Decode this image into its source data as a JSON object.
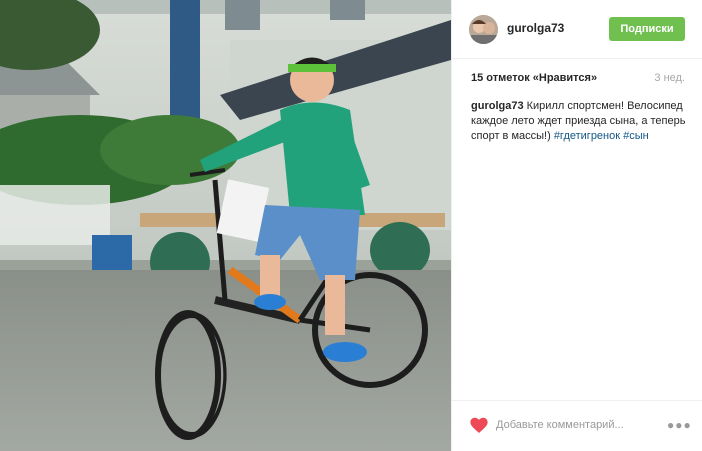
{
  "author": {
    "username": "gurolga73",
    "avatar_icon": "avatar-photo"
  },
  "header": {
    "follow_label": "Подписки"
  },
  "stats": {
    "likes_text": "15 отметок «Нравится»",
    "time_ago": "3 нед."
  },
  "caption": {
    "username": "gurolga73",
    "text": " Кирилл спортсмен! Велосипед каждое лето ждет приезда сына, а теперь спорт в массы!) ",
    "hashtags": [
      "#гдетигренок",
      "#сын"
    ]
  },
  "comment": {
    "placeholder": "Добавьте комментарий..."
  },
  "icons": {
    "like": "heart-icon",
    "more": "more-options-icon"
  },
  "colors": {
    "follow_button": "#70c050",
    "like_heart": "#ed4956",
    "hashtag": "#125688",
    "muted_text": "#a5a7aa"
  }
}
